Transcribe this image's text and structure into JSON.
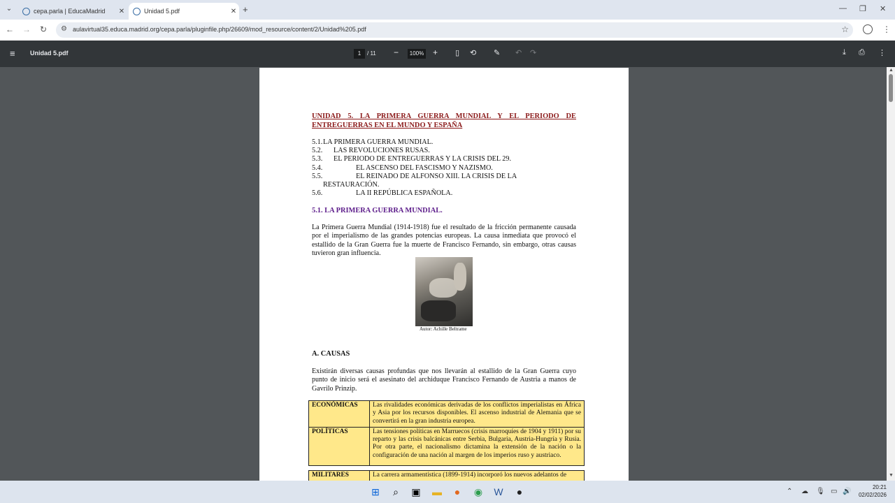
{
  "browser": {
    "tabs": [
      {
        "title": "cepa.parla | EducaMadrid",
        "active": false
      },
      {
        "title": "Unidad 5.pdf",
        "active": true
      }
    ],
    "new_tab": "+",
    "url": "aulavirtual35.educa.madrid.org/cepa.parla/pluginfile.php/26609/mod_resource/content/2/Unidad%205.pdf"
  },
  "pdf_toolbar": {
    "title": "Unidad 5.pdf",
    "page_current": "1",
    "page_total": "/ 11",
    "zoom": "100%"
  },
  "document": {
    "heading": "UNIDAD 5.  LA PRIMERA GUERRA MUNDIAL Y EL PERIODO DE ENTREGUERRAS EN EL MUNDO Y ESPAÑA",
    "toc": [
      {
        "num": "5.1.",
        "text": "LA PRIMERA GUERRA MUNDIAL."
      },
      {
        "num": "5.2.",
        "text": "LAS REVOLUCIONES RUSAS."
      },
      {
        "num": "5.3.",
        "text": "EL PERIODO DE ENTREGUERRAS Y LA CRISIS DEL 29."
      },
      {
        "num": "5.4.",
        "text": "EL ASCENSO DEL FASCISMO Y NAZISMO."
      },
      {
        "num": "5.5.",
        "text": "EL REINADO DE ALFONSO XIII. LA CRISIS DE LA",
        "cont": "RESTAURACIÓN."
      },
      {
        "num": "5.6.",
        "text": "LA II REPÚBLICA ESPAÑOLA."
      }
    ],
    "section_title": "5.1. LA PRIMERA GUERRA MUNDIAL.",
    "intro": "La Primera Guerra Mundial (1914-1918) fue el resultado de la fricción permanente causada por el imperialismo de las grandes potencias europeas. La causa inmediata que provocó el estallido de la Gran Guerra fue la muerte de Francisco Fernando, sin embargo, otras causas tuvieron gran influencia.",
    "image_caption": "Autor: Achille Beltrame",
    "causes_title": "A. CAUSAS",
    "causes_intro": "Existirán diversas causas profundas que nos llevarán al estallido de la Gran Guerra cuyo punto de inicio será el asesinato del archiduque Francisco Fernando de Austria a manos de Gavrilo Prinzip.",
    "causes_table": [
      {
        "key": "ECONÓMICAS",
        "value": "Las rivalidades económicas derivadas de los conflictos imperialistas en África y Asia por los recursos disponibles. El ascenso industrial de Alemania que se convertirá en la gran industria europea."
      },
      {
        "key": "POLÍTICAS",
        "value": "Las tensiones políticas en Marruecos (crisis marroquíes de 1904 y 1911) por su reparto y las crisis balcánicas entre Serbia, Bulgaria, Austria-Hungría y Rusia. Por otra parte, el nacionalismo dictamina la extensión de la nación o la configuración de una nación al margen de los imperios ruso y austriaco."
      },
      {
        "key": "MILITARES",
        "value": "La carrera armamentística (1899-1914) incorporó los nuevos adelantos de"
      }
    ]
  },
  "taskbar": {
    "time": "20:21",
    "date": "02/02/2026"
  }
}
